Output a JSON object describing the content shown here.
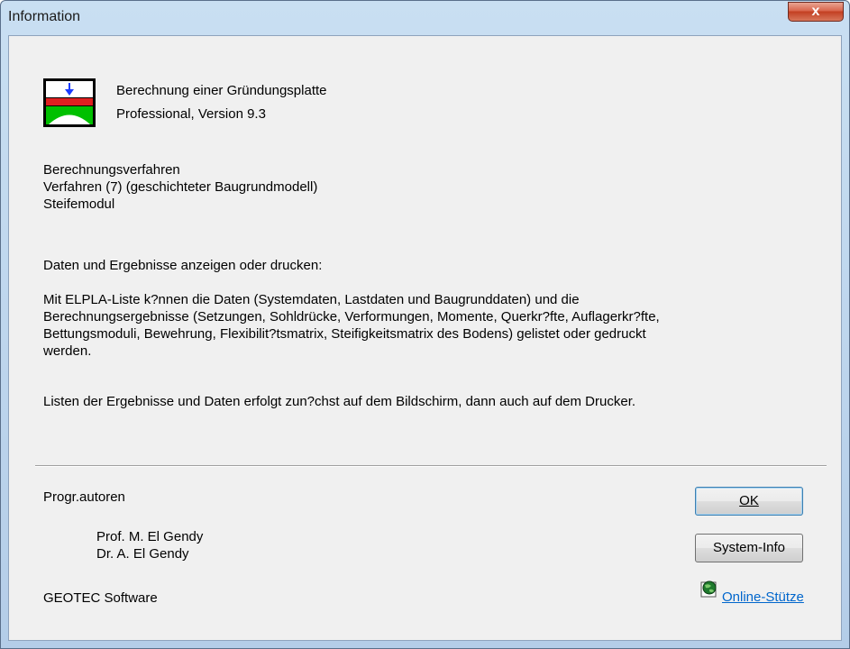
{
  "window": {
    "title": "Information",
    "close_label": "x"
  },
  "header": {
    "line1": "Berechnung einer Gründungsplatte",
    "line2": "Professional, Version 9.3"
  },
  "method": {
    "line1": "Berechnungsverfahren",
    "line2": "Verfahren (7) (geschichteter Baugrundmodell)",
    "line3": "Steifemodul"
  },
  "body": {
    "intro": "Daten und Ergebnisse anzeigen oder drucken:",
    "para1_l1": "Mit ELPLA-Liste k?nnen die Daten (Systemdaten, Lastdaten und Baugrunddaten) und die",
    "para1_l2": "Berechnungsergebnisse (Setzungen, Sohldrücke, Verformungen, Momente, Querkr?fte, Auflagerkr?fte,",
    "para1_l3": "Bettungsmoduli, Bewehrung, Flexibilit?tsmatrix, Steifigkeitsmatrix des Bodens) gelistet oder gedruckt",
    "para1_l4": "werden.",
    "para2": "Listen der Ergebnisse und Daten erfolgt zun?chst auf dem Bildschirm, dann auch auf dem Drucker."
  },
  "authors": {
    "label": "Progr.autoren",
    "author1": "Prof. M. El Gendy",
    "author2": "Dr.   A. El Gendy",
    "company": "GEOTEC Software"
  },
  "buttons": {
    "ok": "OK",
    "sysinfo": "System-Info"
  },
  "link": {
    "online": "Online-Stütze"
  },
  "colors": {
    "link": "#0066cc",
    "icon_red": "#e02020",
    "icon_green": "#00c000",
    "icon_blue": "#1a3cff"
  }
}
